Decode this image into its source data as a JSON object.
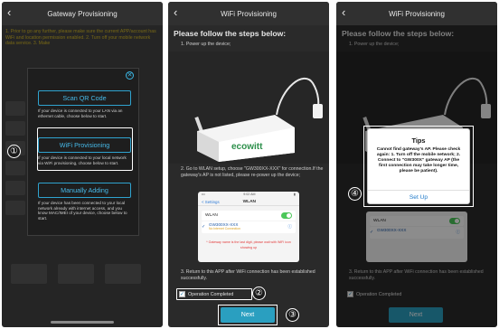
{
  "panel1": {
    "title": "Gateway Provisioning",
    "warning": "1. Prior to go any further, please make sure the current APP/account has WiFi and location permission enabled. 2. Turn off your mobile network data service. 3. Make",
    "options": [
      {
        "label": "Scan QR Code",
        "description": "If your device is connected to your LAN via an ethernet cable, choose below to start."
      },
      {
        "label": "WiFi Provisioning",
        "description": "If your device is connected to your local network via WiFi provisioning, choose below to start."
      },
      {
        "label": "Manually Adding",
        "description": "If your device has been connected to your local network already with internet access, and you know MAC/IMEI of your device, choose below to start."
      }
    ],
    "marker": "①"
  },
  "panel2": {
    "title": "WiFi Provisioning",
    "heading": "Please follow the steps below:",
    "step1": "1.  Power up the device;",
    "brand": "ecowitt",
    "step2": "2.  Go to WLAN setup, choose \"GW300XX-XXX\" for connection.If the gateway's AP is not listed, please re-power up the device;",
    "screenshot": {
      "time": "9:02 AM",
      "back": "< Settings",
      "nav_title": "WLAN",
      "wlan_label": "WLAN",
      "network_name": "GW300XX-XXX",
      "network_sub": "No Internet Connection",
      "red_note": "* Gateway name is the last digit, please wait with WiFi icon showing up"
    },
    "step3": "3.  Return to this APP after WiFi connection has been established successfully.",
    "checkbox_label": "Operation Completed",
    "next_label": "Next",
    "marker_op": "②",
    "marker_next": "③"
  },
  "panel3": {
    "title": "WiFi Provisioning",
    "heading": "Please follow the steps below:",
    "step1": "1.  Power up the device;",
    "step3": "3.  Return to this APP after WiFi connection has been established successfully.",
    "checkbox_label": "Operation Completed",
    "next_label": "Next",
    "tips": {
      "title": "Tips",
      "body": "Cannot find gateway's AP. Please check again: 1. Turn off the mobile network; 2. Connect to \"GW300X\" gateway AP (the first connection may take longer time, please be patient).",
      "action": "Set Up"
    },
    "marker_tips": "④",
    "screenshot": {
      "wlan_label": "WLAN",
      "network_name": "GW300XX-XXX"
    }
  }
}
